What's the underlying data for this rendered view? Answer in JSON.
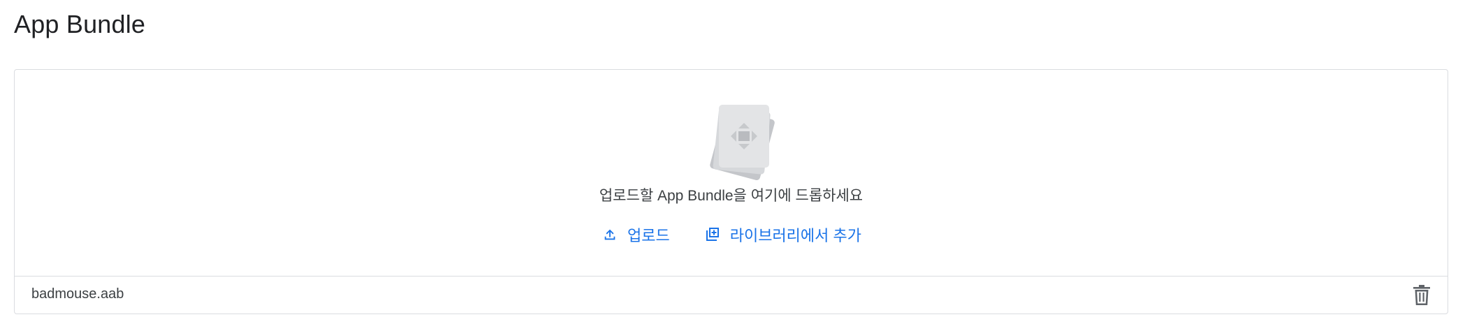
{
  "section": {
    "title": "App Bundle"
  },
  "dropzone": {
    "illustration_icon": "app-bundle-stack-icon",
    "prompt": "업로드할 App Bundle을 여기에 드롭하세요",
    "actions": [
      {
        "label": "업로드",
        "icon": "upload-icon"
      },
      {
        "label": "라이브러리에서 추가",
        "icon": "library-add-icon"
      }
    ]
  },
  "files": [
    {
      "name": "badmouse.aab",
      "action_icon": "trash-icon"
    }
  ],
  "colors": {
    "accent": "#1a73e8",
    "text_primary": "#202124",
    "text_secondary": "#3c4043",
    "border": "#dadce0",
    "icon_gray": "#5f6368"
  }
}
